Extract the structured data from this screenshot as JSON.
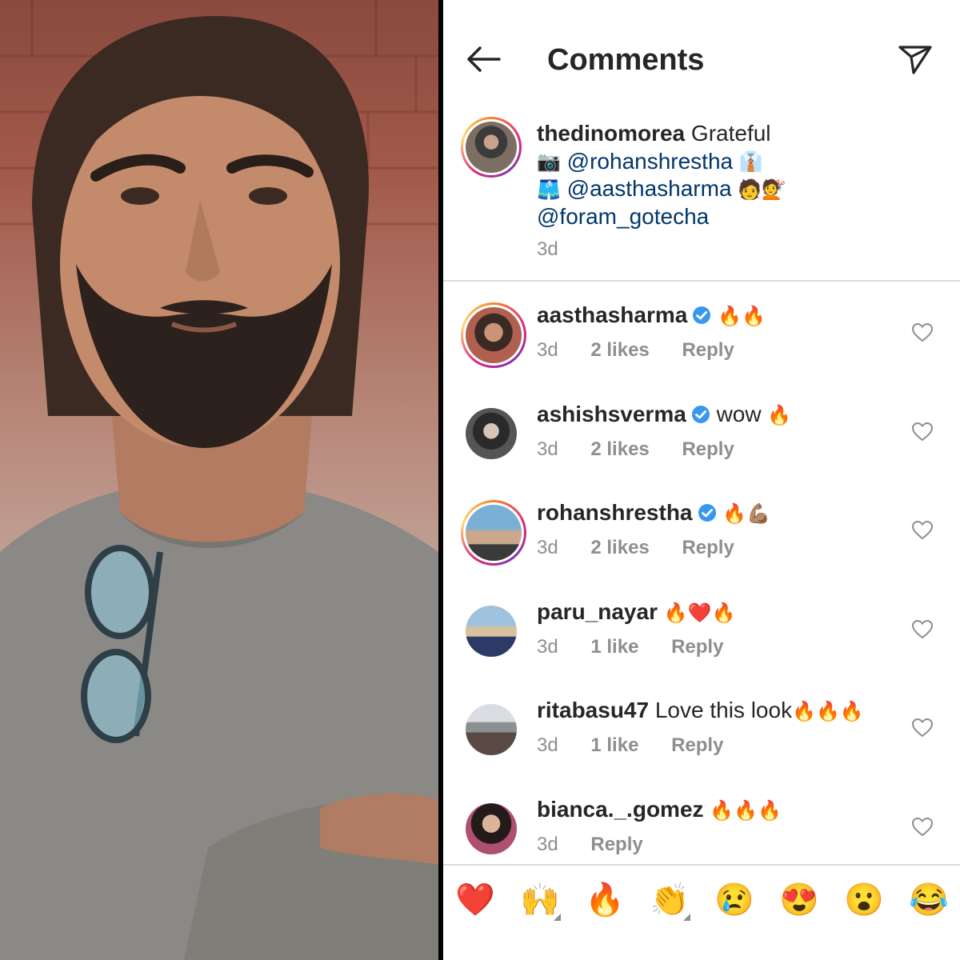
{
  "header": {
    "title": "Comments",
    "back_icon": "arrow-left-icon",
    "share_icon": "paper-plane-icon"
  },
  "caption": {
    "username": "thedinomorea",
    "lines": [
      {
        "prefix": "",
        "text": "Grateful",
        "emoji_after": ""
      },
      {
        "prefix": "📷",
        "mention": "@rohanshrestha",
        "emoji_after": "👔"
      },
      {
        "prefix": "🩳",
        "mention": "@aasthasharma",
        "emoji_after": "🧑💇"
      },
      {
        "prefix": "",
        "mention": "@foram_gotecha",
        "emoji_after": ""
      }
    ],
    "time": "3d"
  },
  "comments": [
    {
      "username": "aasthasharma",
      "verified": true,
      "text": "",
      "emoji": "🔥🔥",
      "time": "3d",
      "likes": "2 likes",
      "reply": "Reply",
      "ring": true
    },
    {
      "username": "ashishsverma",
      "verified": true,
      "text": "wow",
      "emoji": "🔥",
      "time": "3d",
      "likes": "2 likes",
      "reply": "Reply",
      "ring": false
    },
    {
      "username": "rohanshrestha",
      "verified": true,
      "text": "",
      "emoji": "🔥💪🏽",
      "time": "3d",
      "likes": "2 likes",
      "reply": "Reply",
      "ring": true
    },
    {
      "username": "paru_nayar",
      "verified": false,
      "text": "",
      "emoji": "🔥❤️🔥",
      "time": "3d",
      "likes": "1 like",
      "reply": "Reply",
      "ring": false
    },
    {
      "username": "ritabasu47",
      "verified": false,
      "text": "Love this look",
      "emoji": "🔥🔥🔥",
      "time": "3d",
      "likes": "1 like",
      "reply": "Reply",
      "ring": false
    },
    {
      "username": "bianca._.gomez",
      "verified": false,
      "text": "",
      "emoji": "🔥🔥🔥",
      "time": "3d",
      "likes": "",
      "reply": "Reply",
      "ring": false
    }
  ],
  "reactions": [
    "❤️",
    "🙌",
    "🔥",
    "👏",
    "😢",
    "😍",
    "😮",
    "😂"
  ],
  "colors": {
    "verified": "#3897f0",
    "meta": "#8e8e8e",
    "mention": "#00376b",
    "divider": "#dbdbdb"
  }
}
